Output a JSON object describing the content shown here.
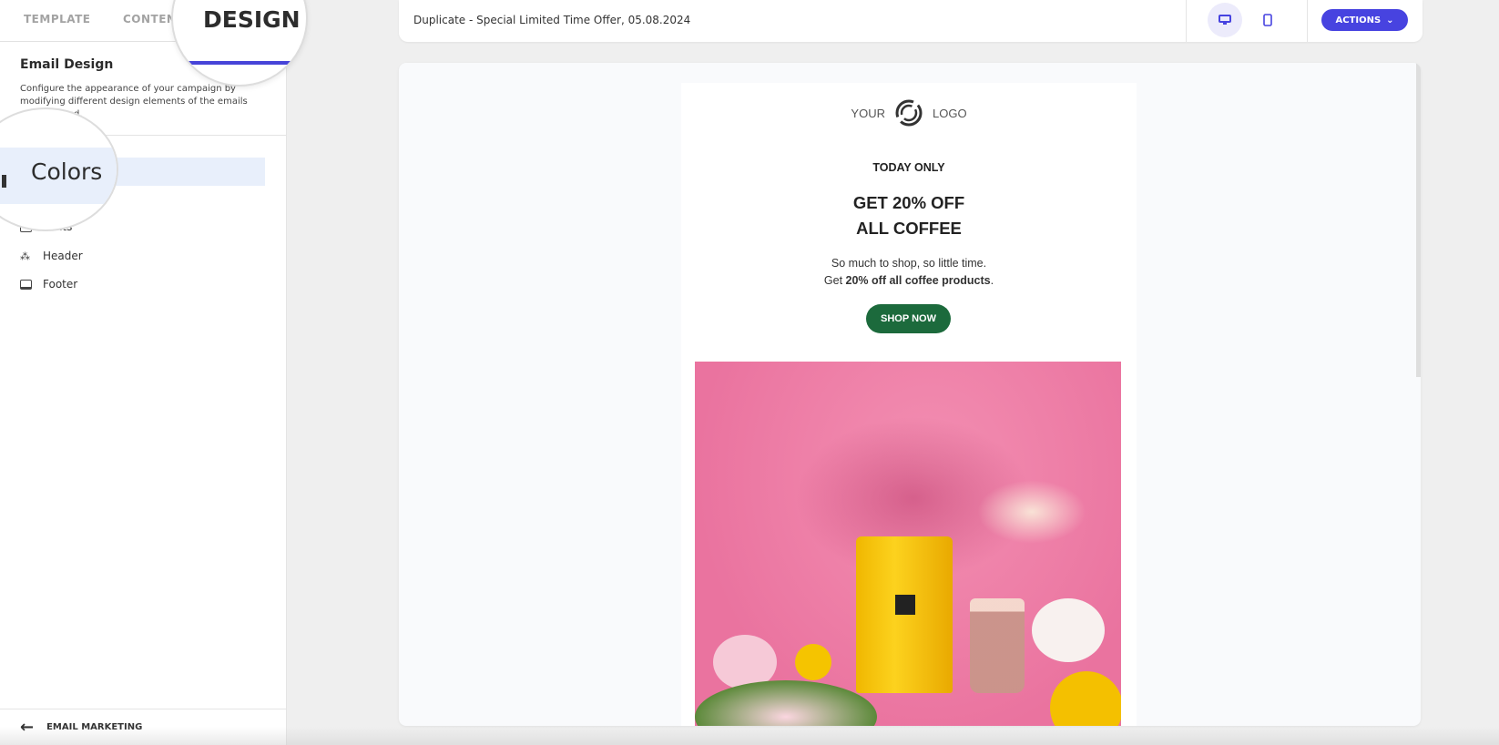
{
  "sidebar": {
    "tabs": [
      {
        "label": "TEMPLATE"
      },
      {
        "label": "CONTENT"
      },
      {
        "label": "DESIGN",
        "active": true
      }
    ],
    "tab_content_visible": "CONTEN",
    "section_title": "Email Design",
    "section_desc": "Configure the appearance of your campaign by modifying different design elements of the emails you will send.",
    "items": [
      {
        "label": "Colors",
        "icon": "palette-icon",
        "active": true
      },
      {
        "label": "Fonts",
        "icon": "font-icon"
      },
      {
        "label": "Header",
        "icon": "shapes-icon"
      },
      {
        "label": "Footer",
        "icon": "footer-icon"
      }
    ],
    "back_label": "EMAIL MARKETING"
  },
  "topbar": {
    "title": "Duplicate - Special Limited Time Offer, 05.08.2024",
    "device_active": "desktop",
    "actions_label": "ACTIONS"
  },
  "email": {
    "logo_left": "YOUR",
    "logo_right": "LOGO",
    "eyebrow": "TODAY ONLY",
    "headline_1": "GET 20% OFF",
    "headline_2": "ALL COFFEE",
    "body_1": "So much to shop, so little time.",
    "body_2_pre": "Get ",
    "body_2_bold": "20% off all coffee products",
    "body_2_post": ".",
    "cta": "SHOP NOW",
    "cta_color": "#1c6a3c"
  },
  "colors": {
    "accent": "#4743e0",
    "active_bg": "#e8effb"
  }
}
